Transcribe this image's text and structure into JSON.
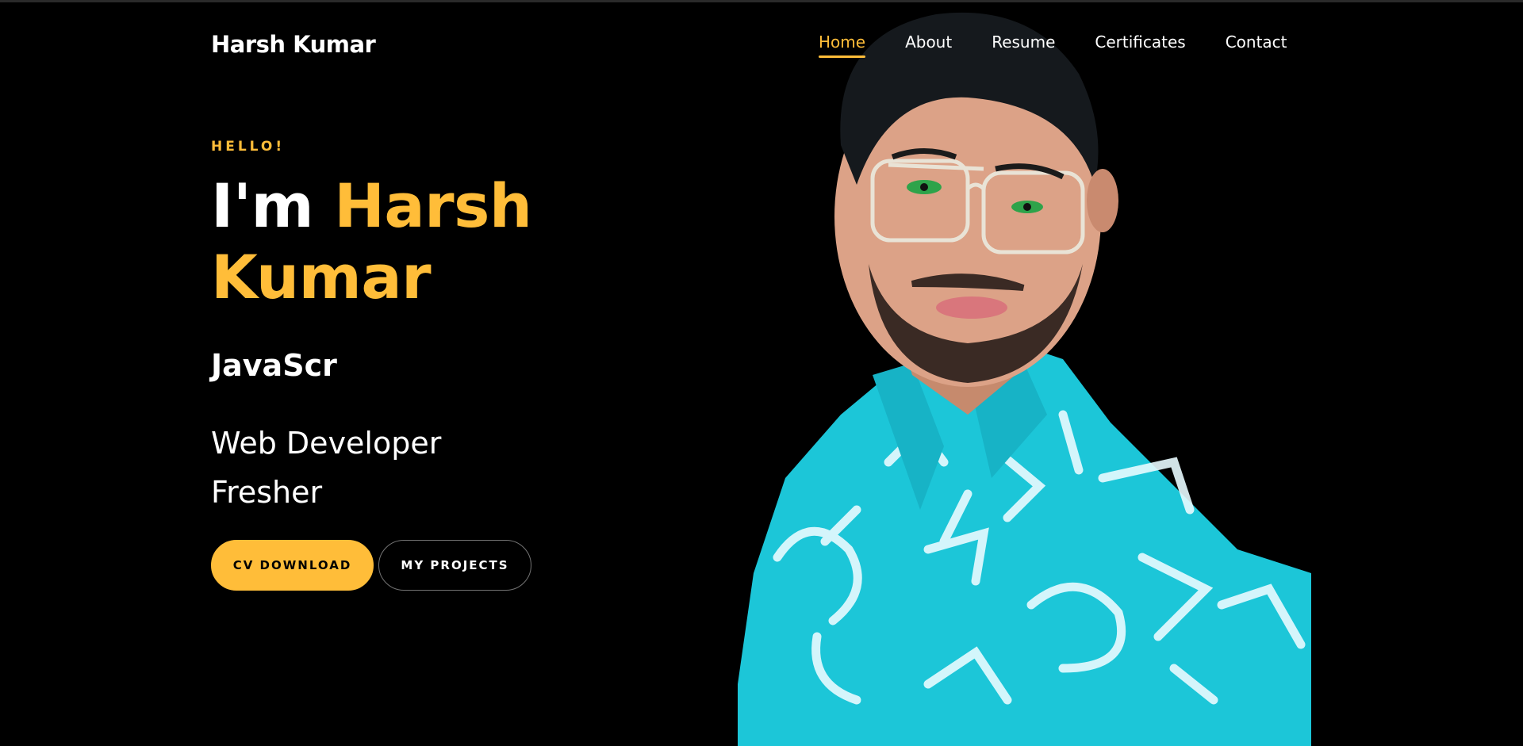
{
  "brand": {
    "name": "Harsh Kumar"
  },
  "nav": {
    "items": [
      {
        "label": "Home",
        "active": true
      },
      {
        "label": "About",
        "active": false
      },
      {
        "label": "Resume",
        "active": false
      },
      {
        "label": "Certificates",
        "active": false
      },
      {
        "label": "Contact",
        "active": false
      }
    ]
  },
  "hero": {
    "greeting": "HELLO!",
    "title_prefix": "I'm",
    "name_first": "Harsh",
    "name_last": "Kumar",
    "typing_text": "JavaScr",
    "roles": [
      "Web Developer",
      "Fresher"
    ],
    "buttons": {
      "primary": "CV DOWNLOAD",
      "secondary": "MY PROJECTS"
    }
  },
  "colors": {
    "background": "#000000",
    "accent": "#ffbd39",
    "text": "#ffffff",
    "shirt": "#1cc6d8"
  },
  "photo": {
    "subject": "portrait of man with glasses wearing turquoise patterned shirt"
  }
}
